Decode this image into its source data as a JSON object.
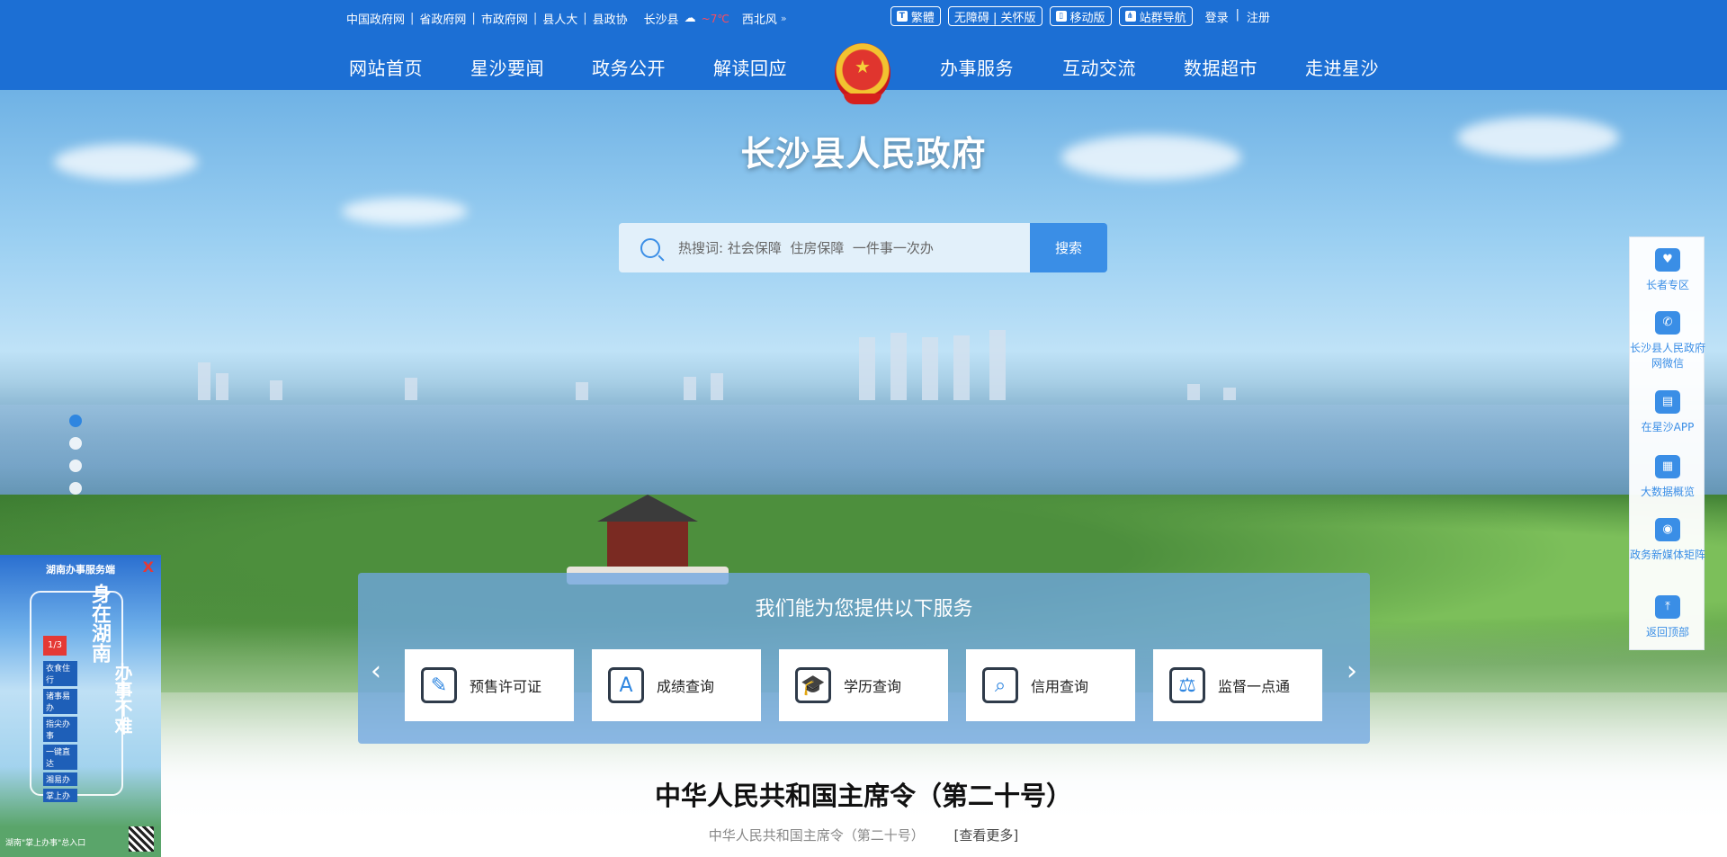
{
  "topbar": {
    "links": [
      "中国政府网",
      "省政府网",
      "市政府网",
      "县人大",
      "县政协"
    ],
    "weather": {
      "location": "长沙县",
      "temp": "~7℃",
      "wind": "西北风"
    },
    "tools": [
      "繁體",
      "无障碍 | 关怀版",
      "移动版",
      "站群导航"
    ],
    "login": "登录",
    "register": "注册"
  },
  "nav": {
    "items": [
      "网站首页",
      "星沙要闻",
      "政务公开",
      "解读回应",
      "办事服务",
      "互动交流",
      "数据超市",
      "走进星沙"
    ]
  },
  "hero": {
    "site_title": "长沙县人民政府",
    "search_placeholder": "热搜词: 社会保障  住房保障  一件事一次办",
    "search_button": "搜索"
  },
  "services": {
    "title": "我们能为您提供以下服务",
    "cards": [
      {
        "label": "预售许可证",
        "icon": "document-edit-icon"
      },
      {
        "label": "成绩查询",
        "icon": "grade-a-icon"
      },
      {
        "label": "学历查询",
        "icon": "graduation-cap-icon"
      },
      {
        "label": "信用查询",
        "icon": "credit-search-icon"
      },
      {
        "label": "监督一点通",
        "icon": "scales-icon"
      }
    ]
  },
  "sidebar": {
    "items": [
      "长者专区",
      "长沙县人民政府网微信",
      "在星沙APP",
      "大数据概览",
      "政务新媒体矩阵",
      "返回顶部"
    ]
  },
  "left_banner": {
    "header": "湖南办事服务端",
    "slogan_1": "身在湖南",
    "slogan_2": "办事不难",
    "logo_text": "1/3",
    "menu": [
      "衣食住行",
      "诸事易办",
      "指尖办事",
      "一键直达",
      "湘易办",
      "掌上办"
    ],
    "footer": "湖南\"掌上办事\"总入口"
  },
  "news": {
    "headline": "中华人民共和国主席令（第二十号）",
    "subline": "中华人民共和国主席令（第二十号）",
    "more": "[查看更多]"
  },
  "colors": {
    "primary": "#1c6fd4",
    "accent": "#3a8ee6",
    "danger": "#e53935"
  }
}
